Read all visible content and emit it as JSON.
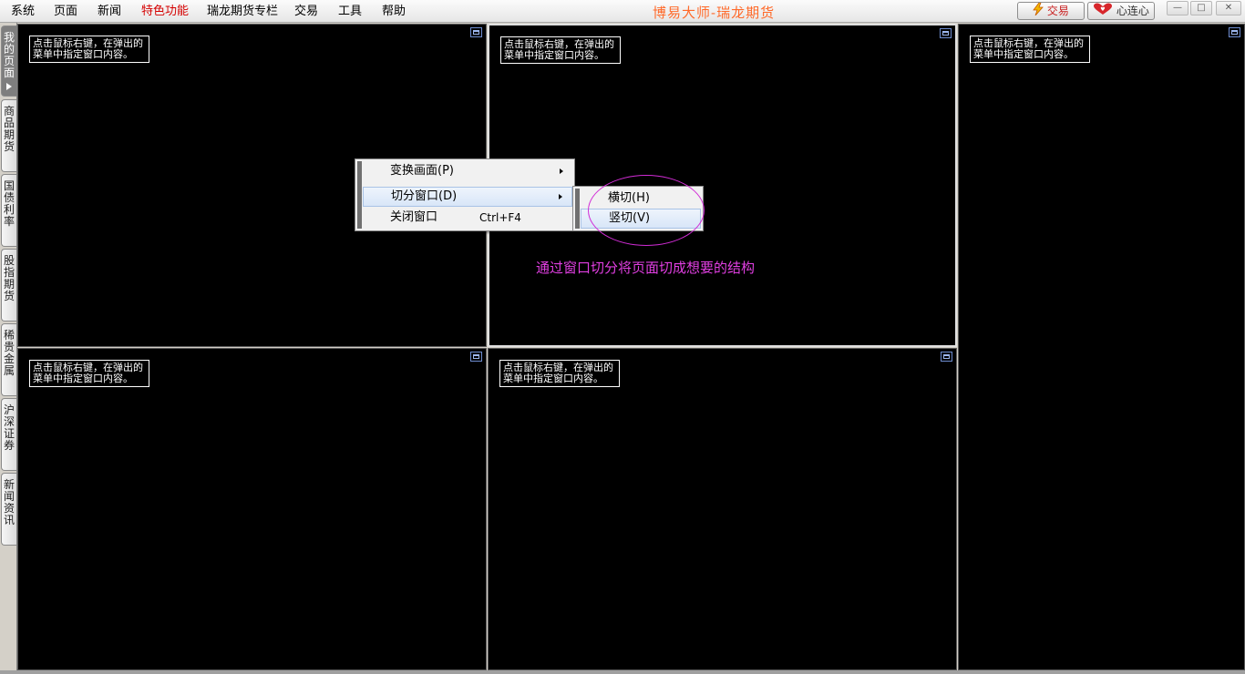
{
  "menubar": {
    "items": [
      {
        "label": "系统"
      },
      {
        "label": "页面"
      },
      {
        "label": "新闻"
      },
      {
        "label": "特色功能"
      },
      {
        "label": "瑞龙期货专栏"
      },
      {
        "label": "交易"
      },
      {
        "label": "工具"
      },
      {
        "label": "帮助"
      }
    ],
    "app_title": "博易大师-瑞龙期货",
    "trade_button": "交易",
    "xinlianxin_button": "心连心",
    "window_controls": {
      "minimize": "—",
      "restore": "□",
      "close": "✕"
    }
  },
  "sidetabs": [
    {
      "label": "我的页面",
      "active": true
    },
    {
      "label": "商品期货",
      "active": false
    },
    {
      "label": "国债利率",
      "active": false
    },
    {
      "label": "股指期货",
      "active": false
    },
    {
      "label": "稀贵金属",
      "active": false
    },
    {
      "label": "沪深证券",
      "active": false
    },
    {
      "label": "新闻资讯",
      "active": false
    }
  ],
  "panes": [
    {
      "hint": "点击鼠标右键，在弹出的\n菜单中指定窗口内容。"
    },
    {
      "hint": "点击鼠标右键，在弹出的\n菜单中指定窗口内容。"
    },
    {
      "hint": "点击鼠标右键，在弹出的\n菜单中指定窗口内容。"
    },
    {
      "hint": "点击鼠标右键，在弹出的\n菜单中指定窗口内容。"
    },
    {
      "hint": "点击鼠标右键，在弹出的\n菜单中指定窗口内容。"
    }
  ],
  "context_menu": {
    "items": [
      {
        "label": "变换画面(P)",
        "has_submenu": true,
        "shortcut": ""
      },
      {
        "label": "切分窗口(D)",
        "has_submenu": true,
        "shortcut": "",
        "highlighted": true
      },
      {
        "label": "关闭窗口",
        "has_submenu": false,
        "shortcut": "Ctrl+F4"
      }
    ]
  },
  "submenu": {
    "items": [
      {
        "label": "横切(H)"
      },
      {
        "label": "竖切(V)",
        "highlighted": true
      }
    ]
  },
  "annotation": "通过窗口切分将页面切成想要的结构",
  "colors": {
    "special_menu": "#d40000",
    "app_title": "#ff6a2a",
    "annotation": "#e23fe3",
    "pane_bg": "#000000"
  }
}
